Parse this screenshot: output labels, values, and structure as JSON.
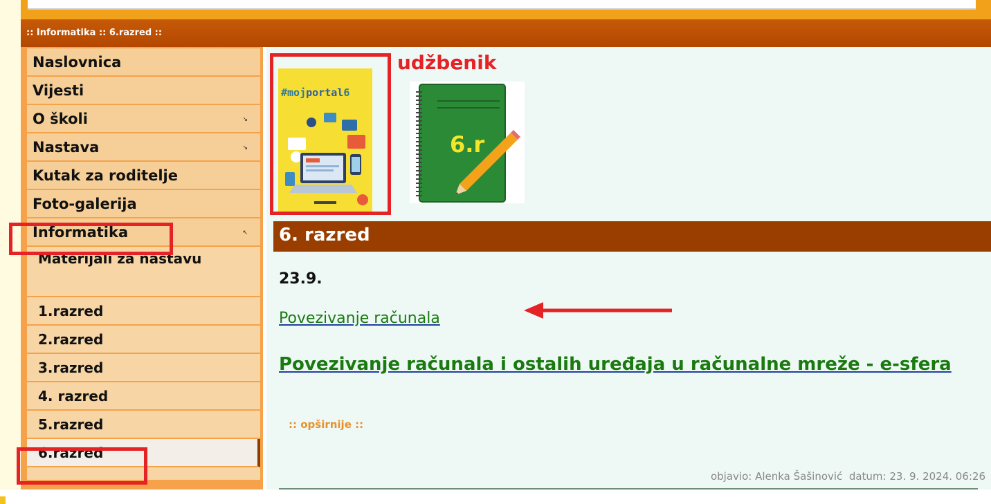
{
  "header": {
    "title": ":: Informatika :: 6.razred ::"
  },
  "sidebar": {
    "items": [
      {
        "label": "Naslovnica"
      },
      {
        "label": "Vijesti"
      },
      {
        "label": "O školi",
        "arrow": "expand-arrow"
      },
      {
        "label": "Nastava",
        "arrow": "expand-arrow"
      },
      {
        "label": "Kutak za roditelje"
      },
      {
        "label": "Foto-galerija"
      },
      {
        "label": "Informatika",
        "arrow": "collapse-arrow"
      }
    ],
    "subitems": [
      {
        "label": "Materijali za nastavu"
      },
      {
        "label": "1.razred"
      },
      {
        "label": "2.razred"
      },
      {
        "label": "3.razred"
      },
      {
        "label": "4. razred"
      },
      {
        "label": "5.razred"
      },
      {
        "label": "6.razred",
        "active": true
      }
    ]
  },
  "images": {
    "textbook_label": "udžbenik",
    "cover_brand_prefix": "#moj",
    "cover_brand_main": "portal",
    "cover_brand_num": "6",
    "notebook_text": "6.r"
  },
  "content": {
    "section_title": "6. razred",
    "date": "23.9.",
    "link1": "Povezivanje računala",
    "link2": "Povezivanje računala i ostalih uređaja u računalne mreže - e-sfera",
    "more": ":: opširnije ::",
    "meta": "objavio: Alenka Šašinović  datum: 23. 9. 2024. 06:26"
  },
  "colors": {
    "header_bg": "#b34700",
    "menu_bg": "#f6cf98",
    "section_bar": "#9a3e00",
    "link": "#1a7a10",
    "highlight": "#e52226"
  }
}
